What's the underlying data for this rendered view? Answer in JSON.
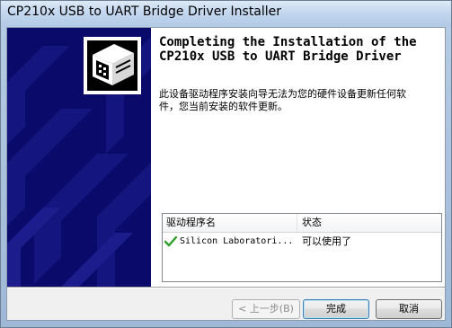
{
  "window": {
    "title": "CP210x USB to UART Bridge Driver Installer"
  },
  "banner": {
    "icon": "device-board-icon",
    "background_color": "#0a0a6b"
  },
  "heading": {
    "line1": "Completing the Installation of the",
    "line2": "CP210x USB to UART Bridge Driver"
  },
  "message": {
    "line1": "此设备驱动程序安装向导无法为您的硬件设备更新任何软",
    "line2": "件，您当前安装的软件更新。"
  },
  "driver_table": {
    "columns": [
      "驱动程序名",
      "状态"
    ],
    "rows": [
      {
        "icon": "checkmark-icon",
        "name": "Silicon Laboratori...",
        "status": "可以使用了"
      }
    ]
  },
  "buttons": {
    "back": "< 上一步(B)",
    "finish": "完成",
    "cancel": "取消"
  },
  "colors": {
    "check_green": "#2e9e2e",
    "default_button_border": "#3c7fb1"
  }
}
